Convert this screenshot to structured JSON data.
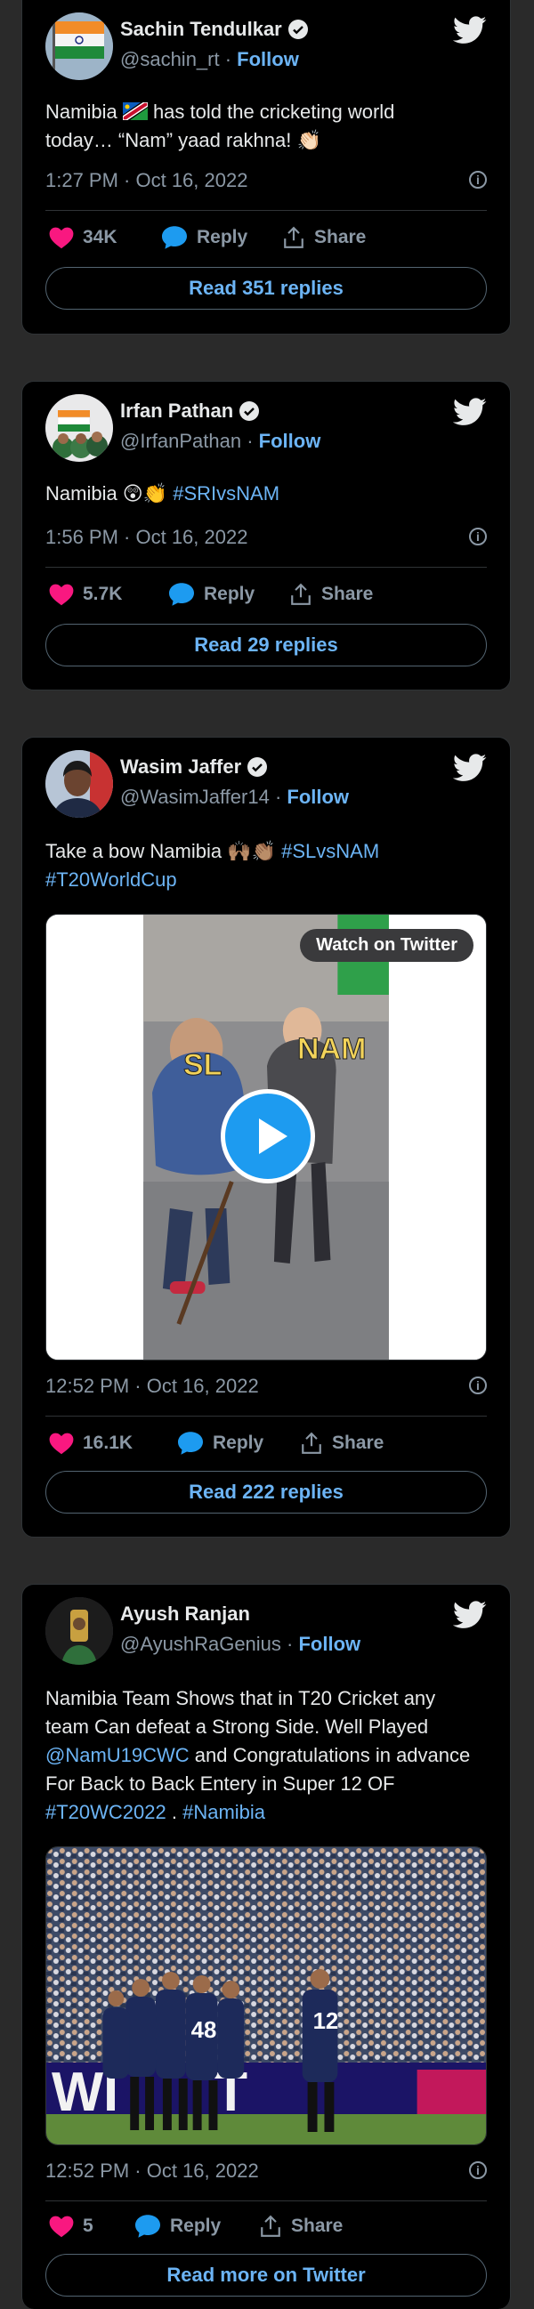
{
  "tweets": [
    {
      "name": "Sachin Tendulkar",
      "handle": "@sachin_rt",
      "follow": "Follow",
      "text_a": "Namibia",
      "text_b": " has told the cricketing world",
      "text_c": "today… “Nam” yaad rakhna! 👏🏻",
      "time": "1:27 PM · Oct 16, 2022",
      "likes": "34K",
      "reply": "Reply",
      "share": "Share",
      "read": "Read 351 replies"
    },
    {
      "name": "Irfan Pathan",
      "handle": "@IrfanPathan",
      "follow": "Follow",
      "text_a": "Namibia 😲👏 ",
      "hashtag": "#SRIvsNAM",
      "time": "1:56 PM · Oct 16, 2022",
      "likes": "5.7K",
      "reply": "Reply",
      "share": "Share",
      "read": "Read 29 replies"
    },
    {
      "name": "Wasim Jaffer",
      "handle": "@WasimJaffer14",
      "follow": "Follow",
      "text_a": "Take a bow Namibia 🙌🏽👏🏽 ",
      "hashtag1": "#SLvsNAM",
      "hashtag2": "#T20WorldCup",
      "watch": "Watch on Twitter",
      "video_left": "SL",
      "video_right": "NAM",
      "time": "12:52 PM · Oct 16, 2022",
      "likes": "16.1K",
      "reply": "Reply",
      "share": "Share",
      "read": "Read 222 replies"
    },
    {
      "name": "Ayush Ranjan",
      "handle": "@AyushRaGenius",
      "follow": "Follow",
      "line1": "Namibia Team Shows that in T20 Cricket any",
      "line2": "team Can defeat a Strong Side. Well Played",
      "mention": "@NamU19CWC",
      "line3_rest": " and Congratulations in advance",
      "line4": "For Back to Back Entery in Super 12 OF",
      "hashtag1": "#T20WC2022",
      "sep": " . ",
      "hashtag2": "#Namibia",
      "jersey1": "48",
      "jersey2": "12",
      "time": "12:52 PM · Oct 16, 2022",
      "likes": "5",
      "reply": "Reply",
      "share": "Share",
      "read": "Read more on Twitter"
    }
  ],
  "colors": {
    "like": "#f91880",
    "reply": "#1d9bf0",
    "link": "#6cb4f5"
  }
}
